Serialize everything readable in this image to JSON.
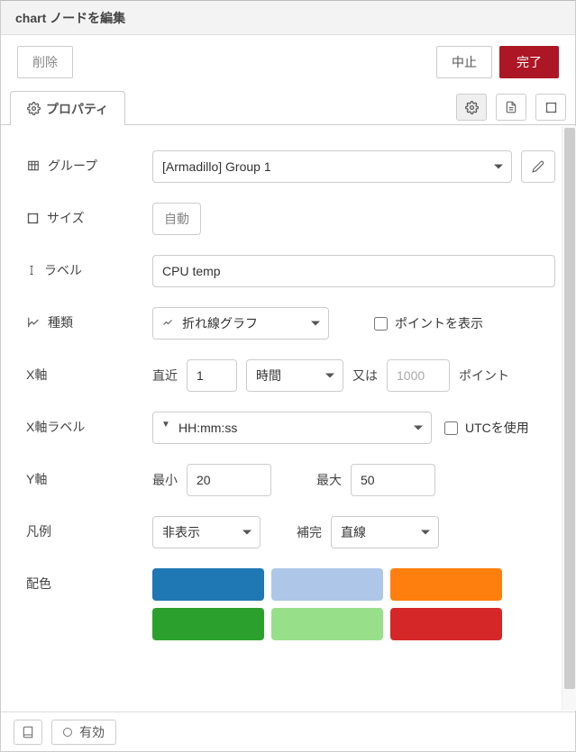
{
  "header": {
    "title": "chart ノードを編集"
  },
  "actions": {
    "delete": "削除",
    "cancel": "中止",
    "done": "完了"
  },
  "tabs": {
    "properties": "プロパティ"
  },
  "form": {
    "group": {
      "label": "グループ",
      "value": "[Armadillo] Group 1"
    },
    "size": {
      "label": "サイズ",
      "value": "自動"
    },
    "labelField": {
      "label": "ラベル",
      "value": "CPU temp"
    },
    "type": {
      "label": "種類",
      "value": "折れ線グラフ",
      "showPoints": "ポイントを表示"
    },
    "xaxis": {
      "label": "X軸",
      "recent": "直近",
      "num": "1",
      "unit": "時間",
      "or": "又は",
      "pointsPlaceholder": "1000",
      "pointsSuffix": "ポイント"
    },
    "xlabel": {
      "label": "X軸ラベル",
      "format": "HH:mm:ss",
      "utc": "UTCを使用"
    },
    "yaxis": {
      "label": "Y軸",
      "minLabel": "最小",
      "min": "20",
      "maxLabel": "最大",
      "max": "50"
    },
    "legend": {
      "label": "凡例",
      "value": "非表示",
      "interpLabel": "補完",
      "interp": "直線"
    },
    "colors": {
      "label": "配色",
      "values": [
        "#1f77b4",
        "#aec7e8",
        "#ff7f0e",
        "#2ca02c",
        "#98df8a",
        "#d62728"
      ]
    }
  },
  "footer": {
    "enabled": "有効"
  }
}
